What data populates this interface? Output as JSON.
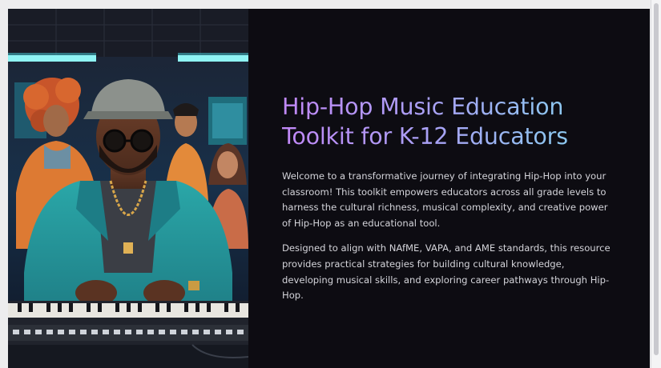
{
  "slide": {
    "title_line1": "Hip-Hop Music Education",
    "title_line2": "Toolkit for K-12 Educators",
    "paragraphs": [
      "Welcome to a transformative journey of integrating Hip-Hop into your classroom! This toolkit empowers educators across all grade levels to harness the cultural richness, musical complexity, and creative power of Hip-Hop as an educational tool.",
      "Designed to align with NAfME, VAPA, and AME standards, this resource provides practical strategies for building cultural knowledge, developing musical skills, and exploring career pathways through Hip-Hop."
    ]
  },
  "colors": {
    "slide_background": "#0d0c12",
    "title_gradient_start": "#c188f7",
    "title_gradient_end": "#86d4ee",
    "body_text": "#d4d4da"
  }
}
